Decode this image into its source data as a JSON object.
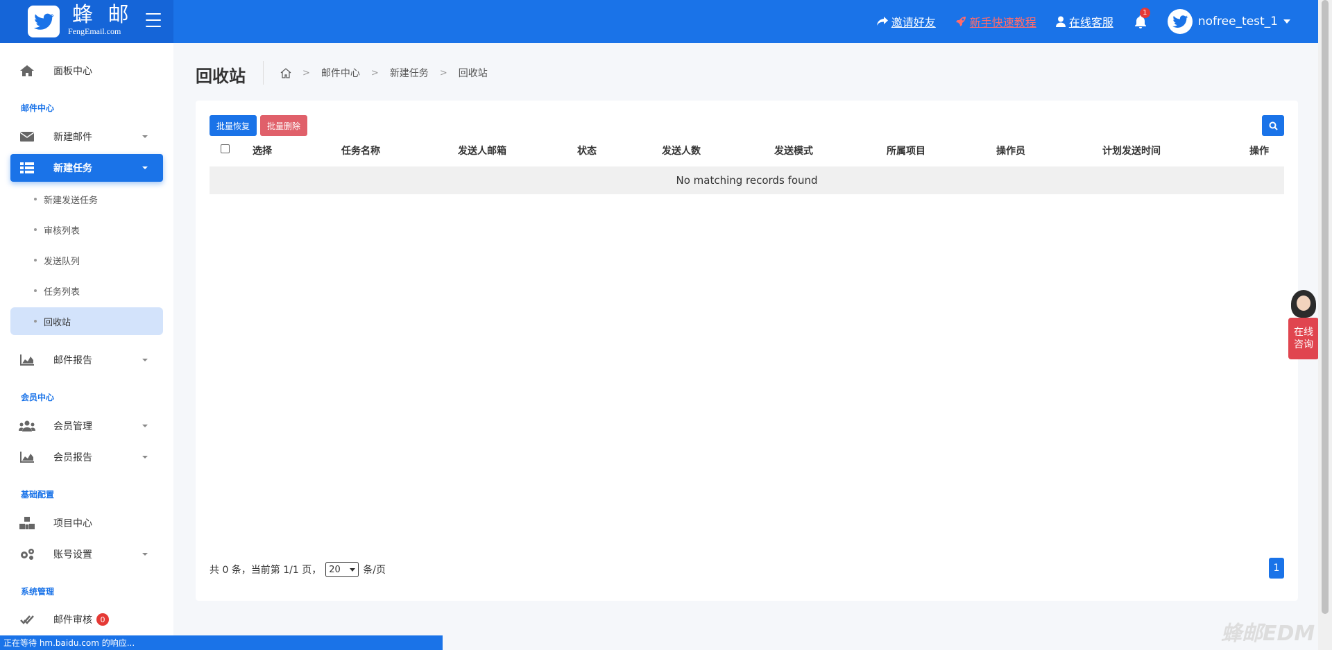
{
  "brand": {
    "name": "蜂 邮",
    "sub": "FengEmail.com"
  },
  "header": {
    "links": [
      {
        "label": "邀请好友",
        "icon": "share-icon"
      },
      {
        "label": "新手快速教程",
        "icon": "rocket-icon"
      },
      {
        "label": "在线客服",
        "icon": "user-icon"
      }
    ],
    "notification_count": "1",
    "username": "nofree_test_1"
  },
  "sidebar": {
    "dashboard": "面板中心",
    "section_mail": "邮件中心",
    "new_mail": "新建邮件",
    "new_task": "新建任务",
    "sub_items": [
      "新建发送任务",
      "审核列表",
      "发送队列",
      "任务列表",
      "回收站"
    ],
    "mail_report": "邮件报告",
    "section_member": "会员中心",
    "member_manage": "会员管理",
    "member_report": "会员报告",
    "section_config": "基础配置",
    "project_center": "项目中心",
    "account_settings": "账号设置",
    "section_system": "系统管理",
    "mail_review": "邮件审核",
    "mail_review_count": "0"
  },
  "page": {
    "title": "回收站",
    "breadcrumb": [
      "邮件中心",
      "新建任务",
      "回收站"
    ]
  },
  "toolbar": {
    "batch_restore": "批量恢复",
    "batch_delete": "批量删除"
  },
  "table": {
    "columns": [
      "选择",
      "任务名称",
      "发送人邮箱",
      "状态",
      "发送人数",
      "发送模式",
      "所属项目",
      "操作员",
      "计划发送时间",
      "操作"
    ],
    "empty_text": "No matching records found"
  },
  "pager": {
    "prefix": "共 0 条，当前第 1/1 页，",
    "page_size": "20",
    "suffix": "条/页",
    "current_page": "1"
  },
  "consult": {
    "line1": "在线",
    "line2": "咨询"
  },
  "statusbar": {
    "text": "正在等待 hm.baidu.com 的响应..."
  },
  "watermark": "蜂邮EDM",
  "colors": {
    "primary": "#1a73e8",
    "danger": "#e0606a",
    "active_sub_bg": "#d3e3fb"
  }
}
